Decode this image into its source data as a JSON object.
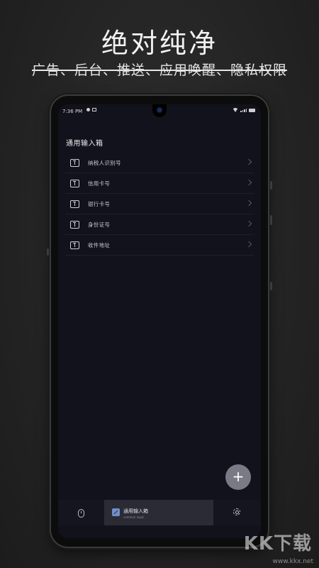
{
  "banner": {
    "headline": "绝对纯净",
    "subline": "广告、后台、推送、应用唤醒、隐私权限"
  },
  "status_bar": {
    "time": "7:36 PM"
  },
  "app": {
    "title": "通用输入箱",
    "items": [
      {
        "label": "纳税人识别号",
        "icon": "input-box-icon"
      },
      {
        "label": "信用卡号",
        "icon": "input-box-icon"
      },
      {
        "label": "银行卡号",
        "icon": "input-box-icon"
      },
      {
        "label": "身份证号",
        "icon": "input-box-icon"
      },
      {
        "label": "收件地址",
        "icon": "input-box-icon"
      }
    ],
    "fab_label": "+"
  },
  "bottom_nav": {
    "active_title": "通用输入箱",
    "active_subtitle": "common input",
    "left_icon": "mouse-icon",
    "right_icon": "gear-icon"
  },
  "watermark": {
    "brand": "KK下载",
    "url": "www.kkx.net"
  },
  "colors": {
    "screen_bg": "#12121c",
    "nav_active_bg": "#2b2b36",
    "fab_bg": "#7a7a86",
    "accent": "#6f8fc8"
  }
}
